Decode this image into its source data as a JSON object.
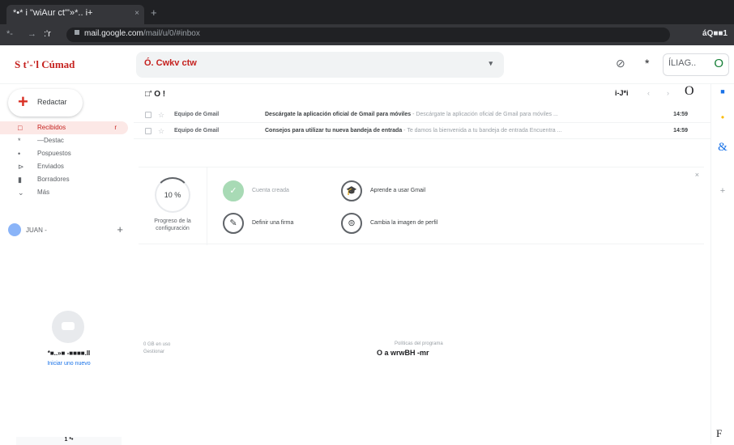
{
  "browser": {
    "tab_title": "*•* i \"wiAur ct\"'»*.. i+",
    "tab_close": "×",
    "new_tab": "+",
    "back": "*-",
    "forward": "→",
    "reload": ":'r",
    "url_host": "mail.google.com",
    "url_path": "/mail/u/0/#inbox",
    "actions": "áQ■■1"
  },
  "header": {
    "logo": "S t'-'l Cúmad",
    "search_placeholder": "Ó. Cwkv ctw",
    "search_caret": "▾",
    "help_icon": "⊘",
    "settings_icon": "*",
    "account_chip": "ÍLIAG..",
    "account_o": "O"
  },
  "sidebar": {
    "compose_label": "Redactar",
    "items": [
      {
        "icon": "□",
        "label": "Recibidos",
        "count": "r"
      },
      {
        "icon": "*",
        "label": "—Destac",
        "count": ""
      },
      {
        "icon": "•",
        "label": "Pospuestos",
        "count": ""
      },
      {
        "icon": "⊳",
        "label": "Enviados",
        "count": ""
      },
      {
        "icon": "▮",
        "label": "Borradores",
        "count": ""
      },
      {
        "icon": "⌄",
        "label": "Más",
        "count": ""
      }
    ],
    "user_name": "JUAN -",
    "user_add": "+",
    "hangouts_label": "*■..»■ -■■■■.II",
    "hangouts_link": "Iniciar uno nuevo",
    "bottom_tab": "1 *•"
  },
  "toolbar": {
    "select": "□' O !",
    "pages": "i-J*i",
    "prev": "‹",
    "next": "›",
    "more": "O"
  },
  "emails": [
    {
      "sender": "Equipo de Gmail",
      "subject": "Descárgate la aplicación oficial de Gmail para móviles",
      "snippet": " - Descárgate la aplicación oficial de Gmail para móviles ...",
      "time": "14:59"
    },
    {
      "sender": "Equipo de Gmail",
      "subject": "Consejos para utilizar tu nueva bandeja de entrada",
      "snippet": " - Te damos la bienvenida a tu bandeja de entrada Encuentra ...",
      "time": "14:59"
    }
  ],
  "setup": {
    "close": "×",
    "progress": "10 %",
    "progress_label": "Progreso de la configuración",
    "steps": [
      {
        "icon": "✓",
        "label": "Cuenta creada"
      },
      {
        "icon": "✎",
        "label": "Definir una firma"
      },
      {
        "icon": "🎓",
        "label": "Aprende a usar Gmail"
      },
      {
        "icon": "⊜",
        "label": "Cambia la imagen de perfil"
      }
    ]
  },
  "footer": {
    "storage": "0 GB en uso",
    "manage": "Gestionar",
    "policy_label": "Políticas del programa",
    "policy": "O a wrwBH -mr"
  },
  "rail": {
    "calendar_icon": "■",
    "keep_icon": "•",
    "tasks_icon": "&",
    "add_icon": "+",
    "bottom": "F"
  },
  "colors": {
    "accent": "#c5221f",
    "active_bg": "#fce8e6",
    "link": "#1a73e8"
  }
}
